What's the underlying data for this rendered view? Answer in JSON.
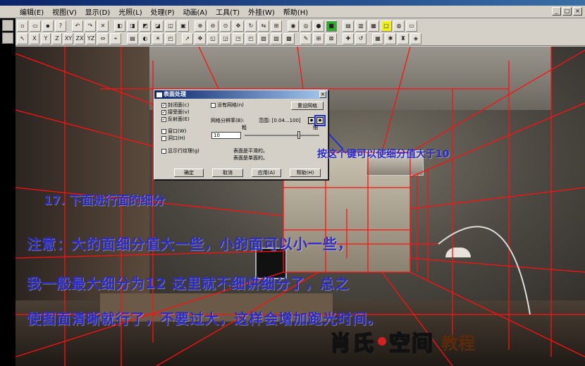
{
  "menu": [
    "编辑(E)",
    "视图(V)",
    "显示(D)",
    "光照(L)",
    "处理(P)",
    "动画(A)",
    "工具(T)",
    "外挂(W)",
    "帮助(H)"
  ],
  "toolbar_row2_labels": [
    "X",
    "Y",
    "Z",
    "XY",
    "ZX",
    "YZ"
  ],
  "dialog": {
    "title": "表面处理",
    "close": "×",
    "chk_closed": "封闭面(c)",
    "chk_receive": "接受面(v)",
    "chk_reflect": "反射面(E)",
    "chk_nomesh": "没有网格(n)",
    "chk_window": "窗口(W)",
    "chk_hole": "洞口(H)",
    "chk_texture": "显示行纹理(g)",
    "reset_mesh": "重设网格",
    "mesh_ratio_label": "网格分辨率(B):",
    "range_label": "范围: [0.04...100]",
    "coarse_label": "粗",
    "fine_label": "细",
    "mesh_value": "10",
    "info_line1": "表面是平滑的。",
    "info_line2": "表面是单面的。",
    "btn_ok": "确定",
    "btn_cancel": "取消",
    "btn_apply": "应用(A)",
    "btn_help": "帮助(H)"
  },
  "annotations": {
    "hint": "按这个键可以使细分值大于10",
    "step": "17. 下面进行面的细分",
    "note1": "注意：大的面细分值大一些，小的面可以小一些，",
    "note2": "我一般最大细分为12 这里就不细讲细分了，总之",
    "note3": "使图面清晰就行了，不要过大，这样会增加跑光时间。"
  },
  "brand": {
    "name_left": "肖氏",
    "name_right": "空间",
    "subtitle": "教程"
  },
  "colors": {
    "annotation": "#2b2cc8",
    "mesh_lines": "#ff1010",
    "dialog_title": "#0a246a"
  }
}
